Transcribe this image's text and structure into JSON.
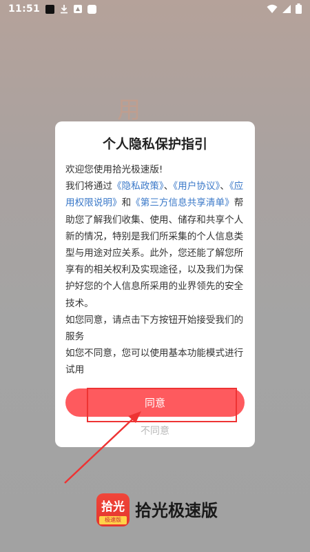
{
  "status_bar": {
    "time": "11:51"
  },
  "background": {
    "faded_text": "用"
  },
  "dialog": {
    "title": "个人隐私保护指引",
    "greeting": "欢迎您使用拾光极速版!",
    "intro_prefix": "我们将通过",
    "link_privacy_policy": "《隐私政策》",
    "sep1": "、",
    "link_user_agreement": "《用户协议》",
    "sep2": "、",
    "link_app_permissions": "《应用权限说明》",
    "sep3": "和",
    "link_third_party": "《第三方信息共享清单》",
    "intro_suffix": "帮助您了解我们收集、使用、储存和共享个人新的情况，特别是我们所采集的个人信息类型与用途对应关系。此外，您还能了解您所享有的相关权利及实现途径，以及我们为保护好您的个人信息所采用的业界领先的安全技术。",
    "agree_hint": "如您同意，请点击下方按钮开始接受我们的服务",
    "disagree_hint": "如您不同意，您可以使用基本功能模式进行试用",
    "agree_label": "同意",
    "disagree_label": "不同意"
  },
  "app": {
    "logo_main": "拾光",
    "logo_sub": "极速版",
    "name": "拾光极速版"
  },
  "colors": {
    "accent": "#fe5a5e",
    "link": "#3a78c8",
    "annotation": "#ee3333"
  },
  "icons": {
    "wifi": "wifi-icon",
    "signal": "signal-icon",
    "battery": "battery-icon",
    "download": "download-icon"
  }
}
